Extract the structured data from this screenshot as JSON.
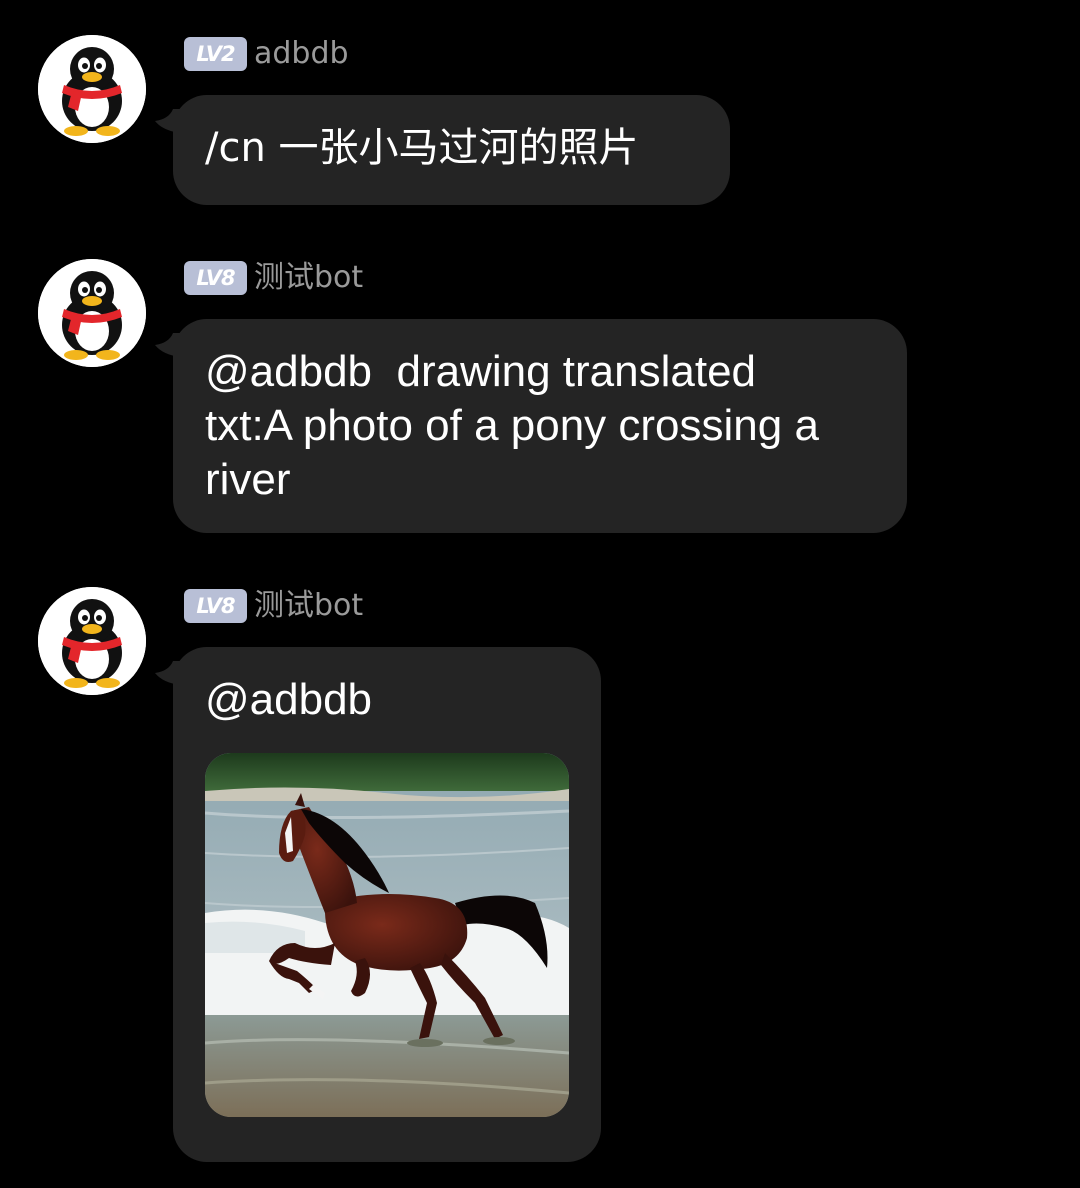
{
  "messages": [
    {
      "level": "LV2",
      "sender": "adbdb",
      "text": "/cn 一张小马过河的照片"
    },
    {
      "level": "LV8",
      "sender": "测试bot",
      "text": "@adbdb  drawing translated\ntxt:A photo of a pony crossing a\nriver"
    },
    {
      "level": "LV8",
      "sender": "测试bot",
      "text": "@adbdb",
      "image": "horse-crossing-river-photo"
    }
  ],
  "colors": {
    "background": "#000000",
    "bubble": "#242424",
    "badge": "#b8bfd6",
    "sender_name": "#9a9a9a",
    "text": "#ffffff"
  },
  "icons": {
    "avatar": "penguin-avatar-icon",
    "bubble_tail": "bubble-tail-icon"
  }
}
